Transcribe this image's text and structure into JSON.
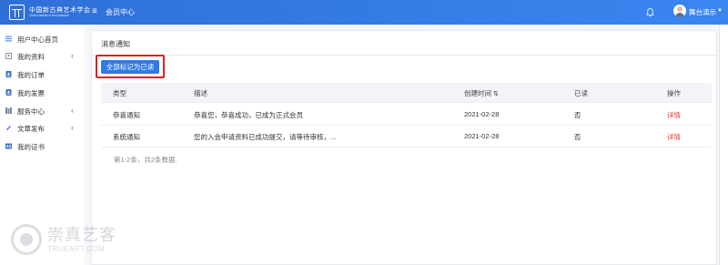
{
  "header": {
    "logo_text": "中国新古典艺术学会",
    "logo_subtitle": "China Institute of Neo-classical",
    "menu_toggle": "≡",
    "title": "会员中心",
    "username": "舞台演示",
    "caret": "▼"
  },
  "sidebar": {
    "items": [
      {
        "label": "用户中心首页",
        "icon": "list-icon",
        "has_arrow": false
      },
      {
        "label": "我的资料",
        "icon": "profile-icon",
        "has_arrow": true
      },
      {
        "label": "我的订单",
        "icon": "order-icon",
        "has_arrow": false
      },
      {
        "label": "我的发票",
        "icon": "invoice-icon",
        "has_arrow": false
      },
      {
        "label": "服务中心",
        "icon": "service-icon",
        "has_arrow": true
      },
      {
        "label": "文章发布",
        "icon": "pen-icon",
        "has_arrow": true
      },
      {
        "label": "我的证书",
        "icon": "certificate-icon",
        "has_arrow": false
      }
    ],
    "arrow": "‹"
  },
  "main": {
    "panel_title": "消息通知",
    "mark_all_button": "全部标记为已读",
    "table": {
      "headers": [
        "类型",
        "描述",
        "创建时间",
        "已读",
        "操作"
      ],
      "rows": [
        {
          "type": "恭喜通知",
          "desc": "恭喜您，恭喜成功，已成为正式会员",
          "time": "2021-02-28",
          "read": "否",
          "action": "详情"
        },
        {
          "type": "系统通知",
          "desc": "您的入会申请资料已成功提交，请等待审核，...",
          "time": "2021-02-28",
          "read": "否",
          "action": "详情"
        }
      ]
    },
    "summary": "第1-2条，共2条数据."
  },
  "watermark": {
    "cn": "崇真艺客",
    "en": "TRUEART.COM"
  },
  "colors": {
    "topbar": "#2f6fd8",
    "accent": "#2f7ae5",
    "highlight": "#e02020",
    "detail_link": "#e03a3a"
  }
}
